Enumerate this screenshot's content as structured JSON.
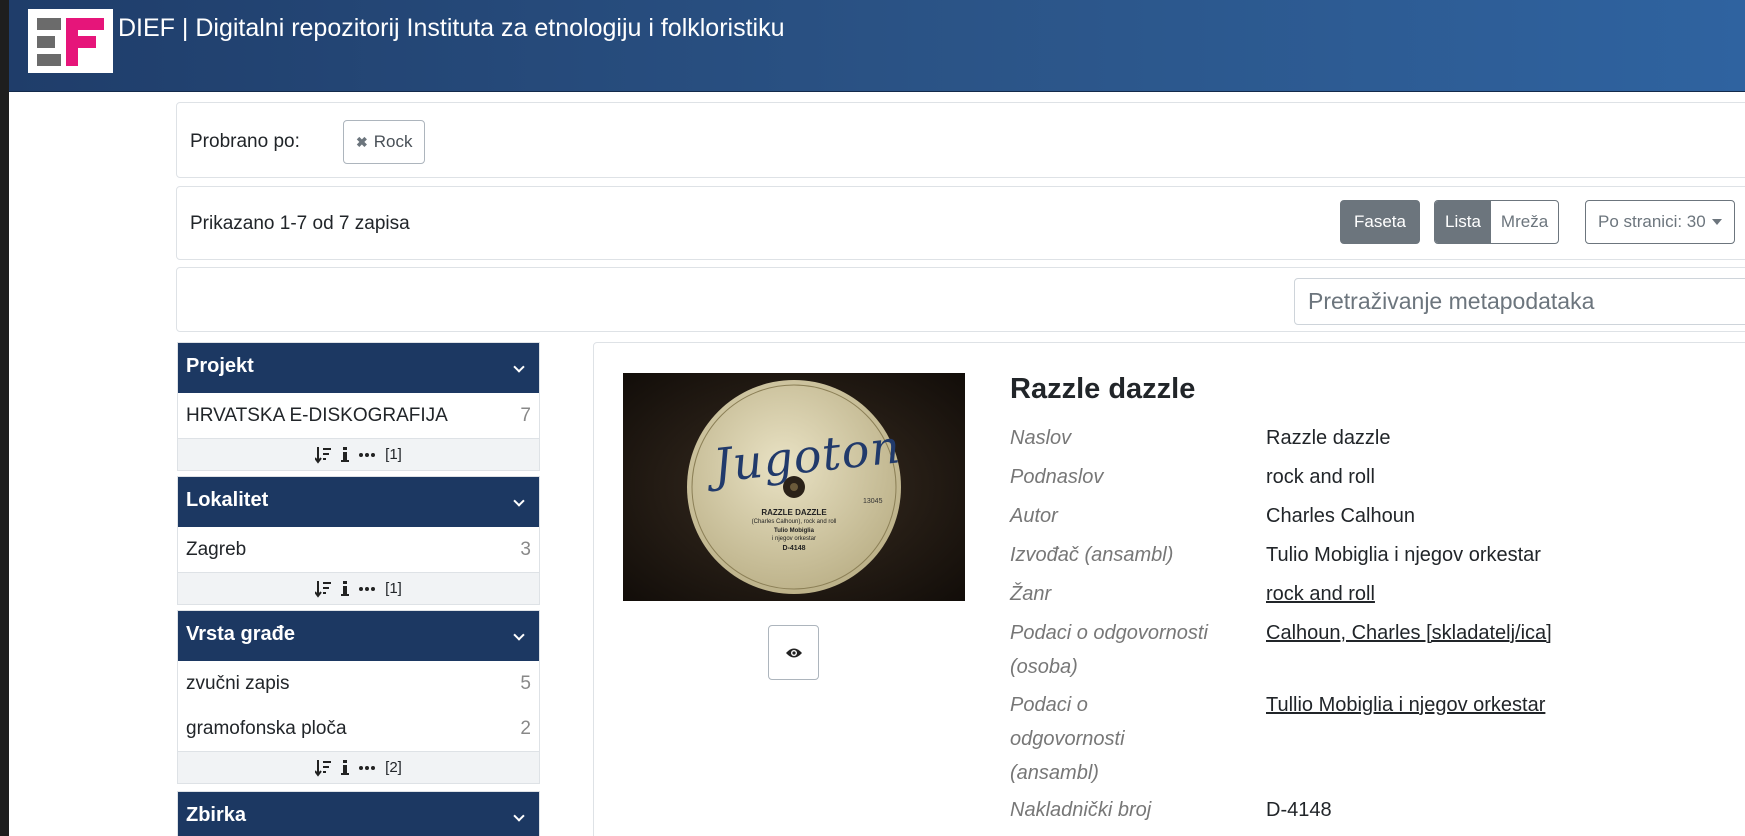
{
  "header": {
    "title": "DIEF | Digitalni repozitorij Instituta za etnologiju i folkloristiku"
  },
  "filter": {
    "label": "Probrano po:",
    "chips": [
      {
        "label": "Rock"
      }
    ]
  },
  "results": {
    "count_text": "Prikazano 1-7 od 7 zapisa",
    "faceta_label": "Faseta",
    "lista_label": "Lista",
    "mreza_label": "Mreža",
    "per_page_label": "Po stranici: 30"
  },
  "search": {
    "placeholder": "Pretraživanje metapodataka"
  },
  "facets": [
    {
      "title": "Projekt",
      "items": [
        {
          "label": "HRVATSKA E-DISKOGRAFIJA",
          "count": "7"
        }
      ],
      "more": "[1]"
    },
    {
      "title": "Lokalitet",
      "items": [
        {
          "label": "Zagreb",
          "count": "3"
        }
      ],
      "more": "[1]"
    },
    {
      "title": "Vrsta građe",
      "items": [
        {
          "label": "zvučni zapis",
          "count": "5"
        },
        {
          "label": "gramofonska ploča",
          "count": "2"
        }
      ],
      "more": "[2]"
    },
    {
      "title": "Zbirka",
      "items": [],
      "more": ""
    }
  ],
  "record": {
    "title": "Razzle dazzle",
    "thumbnail": {
      "brand": "Jugoton",
      "song": "RAZZLE DAZZLE",
      "line2": "(Charles Calhoun), rock and roll",
      "line3": "Tulio Mobiglia",
      "line4": "i njegov orkestar",
      "number": "D-4148",
      "side_number": "13045"
    },
    "fields": [
      {
        "label": "Naslov",
        "value": "Razzle dazzle"
      },
      {
        "label": "Podnaslov",
        "value": "rock and roll"
      },
      {
        "label": "Autor",
        "value": "Charles Calhoun"
      },
      {
        "label": "Izvođač (ansambl)",
        "value": "Tulio Mobiglia i njegov orkestar"
      },
      {
        "label": "Žanr",
        "value": "rock and roll"
      },
      {
        "label": "Podaci o odgovornosti (osoba)",
        "value": "Calhoun, Charles [skladatelj/ica]"
      },
      {
        "label": "Podaci o odgovornosti (ansambl)",
        "value": "Tullio Mobiglia i njegov orkestar"
      },
      {
        "label": "Nakladnički broj",
        "value": "D-4148"
      }
    ]
  },
  "colors": {
    "header": "#2b5487",
    "facet_header": "#1c3862",
    "logo_pink": "#e6157a"
  }
}
